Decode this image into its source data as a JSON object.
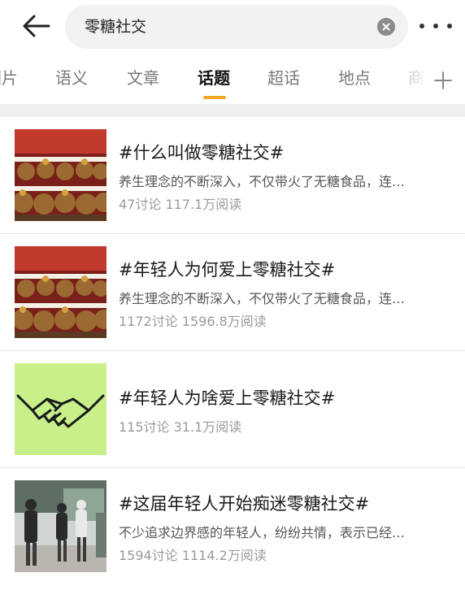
{
  "header": {
    "back_icon": "arrow-left-icon",
    "search_query": "零糖社交",
    "clear_icon": "close-circle-icon",
    "more_icon": "more-horizontal-icon"
  },
  "tabs": [
    {
      "label": "图片",
      "active": false
    },
    {
      "label": "语义",
      "active": false
    },
    {
      "label": "文章",
      "active": false
    },
    {
      "label": "话题",
      "active": true
    },
    {
      "label": "超话",
      "active": false
    },
    {
      "label": "地点",
      "active": false
    },
    {
      "label": "商",
      "active": false
    }
  ],
  "tab_add_icon": "plus-icon",
  "colors": {
    "accent": "#f5a623",
    "separator": "#efefef",
    "thumb_green": "#c8ef8a"
  },
  "topics": [
    {
      "title": "#什么叫做零糖社交#",
      "description": "养生理念的不断深入，不仅带火了无糖食品，连…",
      "stats": "47讨论 117.1万阅读",
      "thumbnail": "plush-toys-image"
    },
    {
      "title": "#年轻人为何爱上零糖社交#",
      "description": "养生理念的不断深入，不仅带火了无糖食品，连…",
      "stats": "1172讨论 1596.8万阅读",
      "thumbnail": "plush-toys-image"
    },
    {
      "title": "#年轻人为啥爱上零糖社交#",
      "description": "",
      "stats": "115讨论 31.1万阅读",
      "thumbnail": "handshake-icon"
    },
    {
      "title": "#这届年轻人开始痴迷零糖社交#",
      "description": "不少追求边界感的年轻人，纷纷共情，表示已经…",
      "stats": "1594讨论 1114.2万阅读",
      "thumbnail": "people-photo-image"
    }
  ]
}
